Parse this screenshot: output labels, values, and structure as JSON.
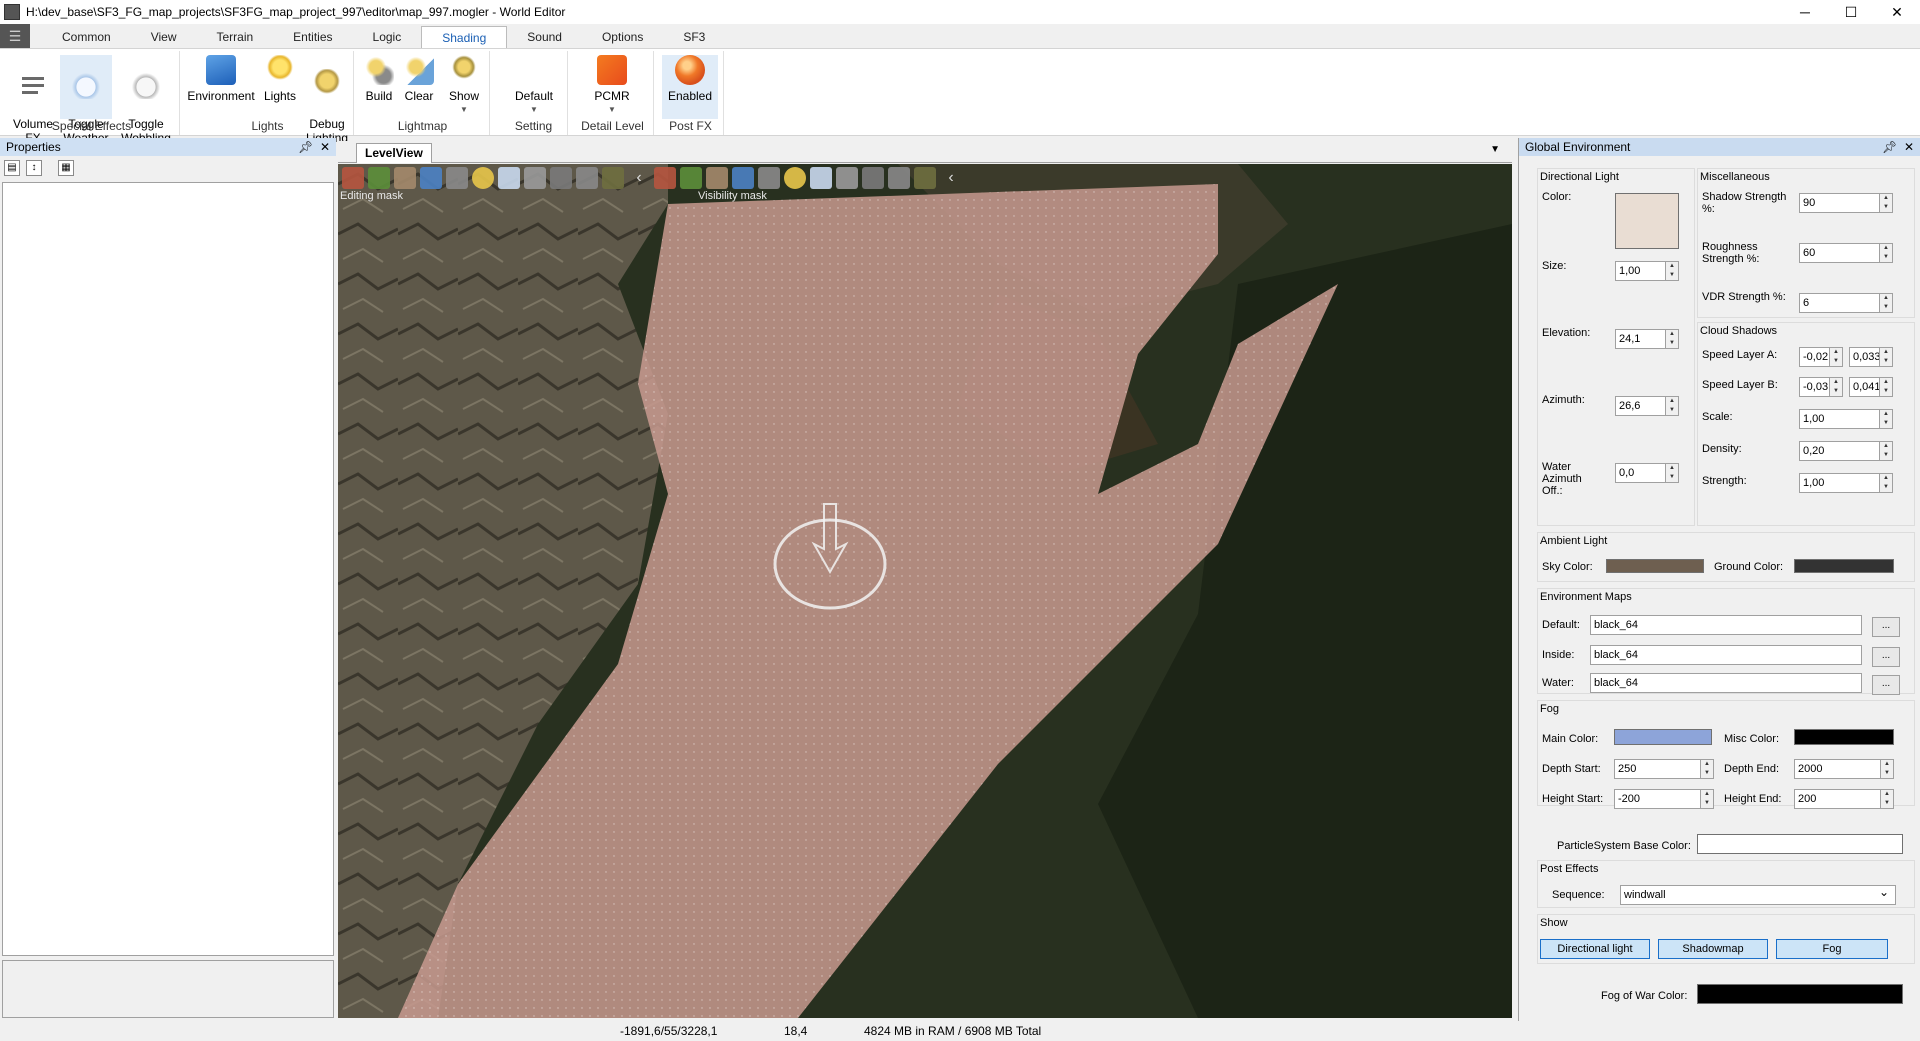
{
  "window": {
    "title": "H:\\dev_base\\SF3_FG_map_projects\\SF3FG_map_project_997\\editor\\map_997.mogler - World Editor",
    "min": "─",
    "max": "☐",
    "close": "✕"
  },
  "menu": {
    "tabs": [
      "Common",
      "View",
      "Terrain",
      "Entities",
      "Logic",
      "Shading",
      "Sound",
      "Options",
      "SF3"
    ],
    "active": "Shading"
  },
  "ribbon": {
    "special_effects": {
      "label": "Special Effects",
      "volume_fx": "Volume\nFX",
      "toggle_weather": "Toggle\nWeather",
      "toggle_wobbling": "Toggle\nWobbling"
    },
    "lights": {
      "label": "Lights",
      "environment": "Environment",
      "lights": "Lights",
      "debug_lighting": "Debug\nLighting"
    },
    "lightmap": {
      "label": "Lightmap",
      "build": "Build",
      "clear": "Clear",
      "show": "Show"
    },
    "setting": {
      "label": "Setting",
      "default": "Default"
    },
    "detail_level": {
      "label": "Detail Level",
      "pcmr": "PCMR"
    },
    "post_fx": {
      "label": "Post FX",
      "enabled": "Enabled"
    }
  },
  "properties": {
    "title": "Properties"
  },
  "level": {
    "tab": "LevelView",
    "editing_mask": "Editing mask",
    "visibility_mask": "Visibility mask"
  },
  "status": {
    "coords": "-1891,6/55/3228,1",
    "fps": "18,4",
    "memory": "4824 MB in RAM / 6908 MB Total"
  },
  "env": {
    "title": "Global Environment",
    "directional": {
      "label": "Directional Light",
      "color_label": "Color:",
      "color": "#e9ddd3",
      "size_label": "Size:",
      "size": "1,00",
      "elevation_label": "Elevation:",
      "elevation": "24,1",
      "azimuth_label": "Azimuth:",
      "azimuth": "26,6",
      "water_label": "Water\nAzimuth\nOff.:",
      "water": "0,0"
    },
    "misc": {
      "label": "Miscellaneous",
      "shadow_label": "Shadow Strength\n%:",
      "shadow": "90",
      "roughness_label": "Roughness\nStrength %:",
      "roughness": "60",
      "vdr_label": "VDR Strength %:",
      "vdr": "6"
    },
    "cloud": {
      "label": "Cloud Shadows",
      "speed_a_label": "Speed Layer A:",
      "speed_a1": "-0,02",
      "speed_a2": "0,033",
      "speed_b_label": "Speed Layer B:",
      "speed_b1": "-0,03",
      "speed_b2": "0,041",
      "scale_label": "Scale:",
      "scale": "1,00",
      "density_label": "Density:",
      "density": "0,20",
      "strength_label": "Strength:",
      "strength": "1,00"
    },
    "ambient": {
      "label": "Ambient Light",
      "sky_label": "Sky Color:",
      "sky": "#6e5f50",
      "ground_label": "Ground Color:",
      "ground": "#333333"
    },
    "maps": {
      "label": "Environment Maps",
      "default_label": "Default:",
      "default": "black_64",
      "inside_label": "Inside:",
      "inside": "black_64",
      "water_label": "Water:",
      "water": "black_64",
      "browse": "..."
    },
    "fog": {
      "label": "Fog",
      "main_label": "Main Color:",
      "main": "#8da4d9",
      "misc_label": "Misc Color:",
      "misc": "#000000",
      "depth_start_label": "Depth Start:",
      "depth_start": "250",
      "depth_end_label": "Depth End:",
      "depth_end": "2000",
      "height_start_label": "Height Start:",
      "height_start": "-200",
      "height_end_label": "Height End:",
      "height_end": "200"
    },
    "particle_label": "ParticleSystem Base Color:",
    "particle": "#ffffff",
    "postfx": {
      "label": "Post Effects",
      "sequence_label": "Sequence:",
      "sequence": "windwall"
    },
    "show": {
      "label": "Show",
      "directional": "Directional light",
      "shadowmap": "Shadowmap",
      "fog": "Fog"
    },
    "fow_label": "Fog of War Color:",
    "fow": "#000000"
  }
}
